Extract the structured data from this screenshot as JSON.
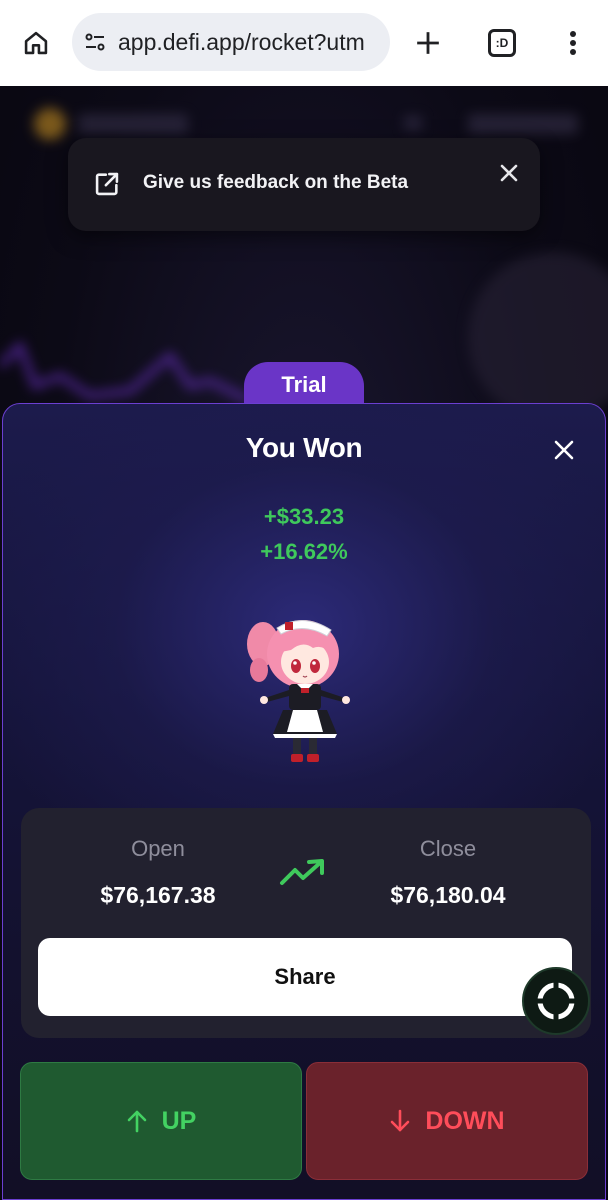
{
  "browser": {
    "url": "app.defi.app/rocket?utm",
    "tab_count": ":D"
  },
  "toast": {
    "message": "Give us feedback on the Beta"
  },
  "trial_label": "Trial",
  "result": {
    "title": "You Won",
    "profit_amount": "+$33.23",
    "profit_percent": "+16.62%",
    "open_label": "Open",
    "open_value": "$76,167.38",
    "close_label": "Close",
    "close_value": "$76,180.04",
    "share_label": "Share"
  },
  "actions": {
    "up_label": "UP",
    "down_label": "DOWN"
  },
  "colors": {
    "profit_green": "#3fc95c",
    "up_green": "#43d262",
    "down_red": "#ff4d5a",
    "accent_purple": "#6a35c7"
  },
  "icons": [
    "home-icon",
    "tune-icon",
    "plus-icon",
    "tabs-icon",
    "more-vert-icon",
    "external-link-icon",
    "close-icon",
    "trending-up-icon",
    "target-icon",
    "arrow-up-icon",
    "arrow-down-icon"
  ]
}
